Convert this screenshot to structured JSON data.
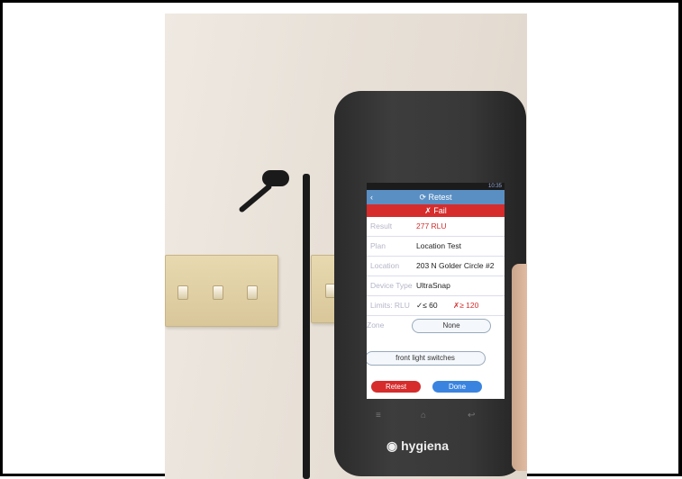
{
  "device": {
    "status_time": "10:35",
    "header_title": "Retest",
    "result_banner": "✗ Fail",
    "rows": [
      {
        "label": "Result",
        "value": "277 RLU"
      },
      {
        "label": "Plan",
        "value": "Location Test"
      },
      {
        "label": "Location",
        "value": "203 N Golder Circle #2"
      },
      {
        "label": "Device Type",
        "value": "UltraSnap"
      },
      {
        "label": "Limits: RLU",
        "pass": "✓≤ 60",
        "fail": "✗≥ 120"
      },
      {
        "label": "Zone",
        "value": "None"
      }
    ],
    "note": "front light switches",
    "retest_button": "Retest",
    "done_button": "Done",
    "brand": "hygiena"
  }
}
